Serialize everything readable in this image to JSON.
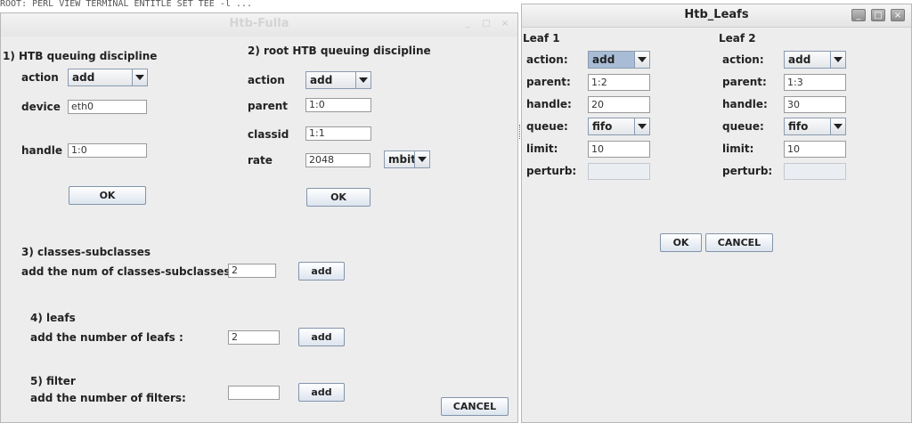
{
  "background_strip": "ROOT: PERL VIEW TERMINAL  ENTITLE  SET TEE  -l ...",
  "win1": {
    "title": "Htb-Fulla",
    "controls": {
      "minimize": "_",
      "maximize": "□",
      "close": "×"
    },
    "section1": {
      "title": "1)   HTB queuing discipline",
      "action_label": "action",
      "action_value": "add",
      "device_label": "device",
      "device_value": "eth0",
      "handle_label": "handle",
      "handle_value": "1:0",
      "ok": "OK"
    },
    "section2": {
      "title": "2)  root HTB queuing discipline",
      "action_label": "action",
      "action_value": "add",
      "parent_label": "parent",
      "parent_value": "1:0",
      "classid_label": "classid",
      "classid_value": "1:1",
      "rate_label": "rate",
      "rate_value": "2048",
      "rate_unit": "mbit",
      "ok": "OK"
    },
    "section3": {
      "title": "3) classes-subclasses",
      "prompt": "add the num of classes-subclasses:",
      "value": "2",
      "add": "add"
    },
    "section4": {
      "title": "4)  leafs",
      "prompt": "add the number of leafs :",
      "value": "2",
      "add": "add"
    },
    "section5": {
      "title": "5) filter",
      "prompt": "add the number of filters:",
      "value": "",
      "add": "add"
    },
    "cancel": "CANCEL"
  },
  "win2": {
    "title": "Htb_Leafs",
    "controls": {
      "minimize": "_",
      "maximize": "□",
      "close": "×"
    },
    "leaf1": {
      "header": "Leaf 1",
      "action_label": "action:",
      "action_value": "add",
      "parent_label": "parent:",
      "parent_value": "1:2",
      "handle_label": "handle:",
      "handle_value": "20",
      "queue_label": "queue:",
      "queue_value": "fifo",
      "limit_label": "limit:",
      "limit_value": "10",
      "perturb_label": "perturb:",
      "perturb_value": ""
    },
    "leaf2": {
      "header": "Leaf 2",
      "action_label": "action:",
      "action_value": "add",
      "parent_label": "parent:",
      "parent_value": "1:3",
      "handle_label": "handle:",
      "handle_value": "30",
      "queue_label": "queue:",
      "queue_value": "fifo",
      "limit_label": "limit:",
      "limit_value": "10",
      "perturb_label": "perturb:",
      "perturb_value": ""
    },
    "ok": "OK",
    "cancel": "CANCEL"
  }
}
